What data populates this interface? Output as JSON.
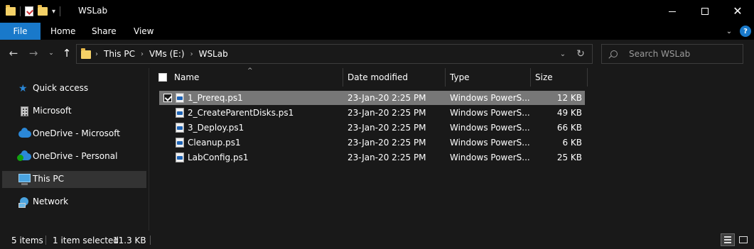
{
  "window": {
    "title": "WSLab",
    "controls": {
      "minimize": "minimize-icon",
      "maximize": "maximize-icon",
      "close": "close-icon"
    },
    "close_glyph": "✕"
  },
  "quick_access_toolbar": {
    "icons": [
      "folder-icon",
      "properties-icon",
      "new-folder-icon",
      "customize-dropdown-icon"
    ],
    "dropdown_glyph": "▾"
  },
  "ribbon": {
    "file_tab": "File",
    "tabs": [
      "Home",
      "Share",
      "View"
    ],
    "expand_glyph": "⌄",
    "help_glyph": "?",
    "accent_color": "#1979ca"
  },
  "navigation": {
    "back_glyph": "←",
    "forward_glyph": "→",
    "recent_glyph": "⌄",
    "up_glyph": "↑"
  },
  "address_bar": {
    "crumbs": [
      "This PC",
      "VMs (E:)",
      "WSLab"
    ],
    "separator": "›",
    "dropdown_glyph": "⌄",
    "refresh_glyph": "↻"
  },
  "search": {
    "placeholder": "Search WSLab",
    "value": ""
  },
  "nav_pane": {
    "items": [
      {
        "label": "Quick access",
        "icon": "star-icon",
        "selected": false
      },
      {
        "label": "Microsoft",
        "icon": "building-icon",
        "selected": false
      },
      {
        "label": "OneDrive - Microsoft",
        "icon": "onedrive-icon",
        "selected": false
      },
      {
        "label": "OneDrive - Personal",
        "icon": "onedrive-icon",
        "selected": false
      },
      {
        "label": "This PC",
        "icon": "computer-icon",
        "selected": true
      },
      {
        "label": "Network",
        "icon": "network-icon",
        "selected": false
      }
    ],
    "star_glyph": "★"
  },
  "file_list": {
    "columns": {
      "name": "Name",
      "date": "Date modified",
      "type": "Type",
      "size": "Size"
    },
    "sort_glyph": "^",
    "files": [
      {
        "name": "1_Prereq.ps1",
        "date": "23-Jan-20 2:25 PM",
        "type": "Windows PowerS...",
        "size": "12 KB",
        "selected": true
      },
      {
        "name": "2_CreateParentDisks.ps1",
        "date": "23-Jan-20 2:25 PM",
        "type": "Windows PowerS...",
        "size": "49 KB",
        "selected": false
      },
      {
        "name": "3_Deploy.ps1",
        "date": "23-Jan-20 2:25 PM",
        "type": "Windows PowerS...",
        "size": "66 KB",
        "selected": false
      },
      {
        "name": "Cleanup.ps1",
        "date": "23-Jan-20 2:25 PM",
        "type": "Windows PowerS...",
        "size": "6 KB",
        "selected": false
      },
      {
        "name": "LabConfig.ps1",
        "date": "23-Jan-20 2:25 PM",
        "type": "Windows PowerS...",
        "size": "25 KB",
        "selected": false
      }
    ]
  },
  "status_bar": {
    "item_count": "5 items",
    "selection": "1 item selected",
    "selection_size": "11.3 KB"
  }
}
